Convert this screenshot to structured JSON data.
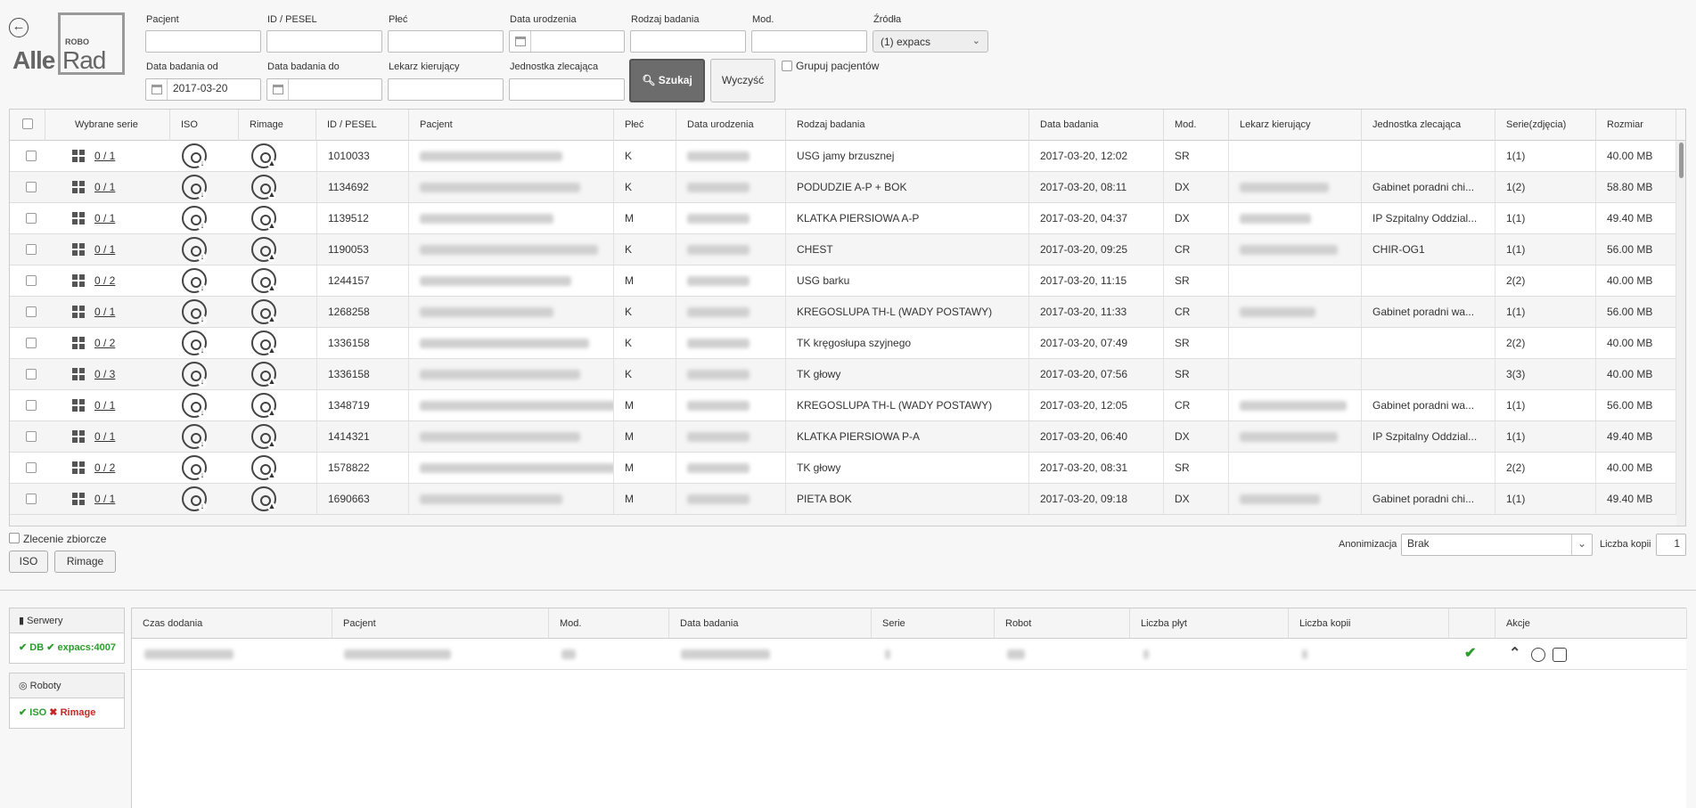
{
  "logo": {
    "alle": "Alle",
    "robo": "ROBO",
    "rad": "Rad"
  },
  "filters": {
    "pacjent": "Pacjent",
    "id_pesel": "ID / PESEL",
    "plec": "Płeć",
    "data_urodzenia": "Data urodzenia",
    "rodzaj_badania": "Rodzaj badania",
    "mod": "Mod.",
    "zrodla": "Źródła",
    "zrodla_value": "(1) expacs",
    "data_od": "Data badania od",
    "data_od_value": "2017-03-20",
    "data_do": "Data badania do",
    "lekarz": "Lekarz kierujący",
    "jednostka": "Jednostka zlecająca",
    "search_label": "Szukaj",
    "clear_label": "Wyczyść",
    "group_label": "Grupuj pacjentów"
  },
  "table": {
    "headers": [
      "Wybrane serie",
      "ISO",
      "Rimage",
      "ID / PESEL",
      "Pacjent",
      "Płeć",
      "Data urodzenia",
      "Rodzaj badania",
      "Data badania",
      "Mod.",
      "Lekarz kierujący",
      "Jednostka zlecająca",
      "Serie(zdjęcia)",
      "Rozmiar"
    ],
    "rows": [
      {
        "sel": "0 / 1",
        "id": "1010033",
        "plec": "K",
        "rodzaj": "USG jamy brzusznej",
        "data": "2017-03-20, 12:02",
        "mod": "SR",
        "lekarz": false,
        "jednostka": "",
        "serie": "1(1)",
        "rozmiar": "40.00 MB"
      },
      {
        "sel": "0 / 1",
        "id": "1134692",
        "plec": "K",
        "rodzaj": "PODUDZIE A-P + BOK",
        "data": "2017-03-20, 08:11",
        "mod": "DX",
        "lekarz": true,
        "jednostka": "Gabinet poradni chi...",
        "serie": "1(2)",
        "rozmiar": "58.80 MB"
      },
      {
        "sel": "0 / 1",
        "id": "1139512",
        "plec": "M",
        "rodzaj": "KLATKA PIERSIOWA A-P",
        "data": "2017-03-20, 04:37",
        "mod": "DX",
        "lekarz": true,
        "jednostka": "IP Szpitalny Oddzial...",
        "serie": "1(1)",
        "rozmiar": "49.40 MB"
      },
      {
        "sel": "0 / 1",
        "id": "1190053",
        "plec": "K",
        "rodzaj": "CHEST",
        "data": "2017-03-20, 09:25",
        "mod": "CR",
        "lekarz": true,
        "jednostka": "CHIR-OG1",
        "serie": "1(1)",
        "rozmiar": "56.00 MB"
      },
      {
        "sel": "0 / 2",
        "id": "1244157",
        "plec": "M",
        "rodzaj": "USG barku",
        "data": "2017-03-20, 11:15",
        "mod": "SR",
        "lekarz": false,
        "jednostka": "",
        "serie": "2(2)",
        "rozmiar": "40.00 MB"
      },
      {
        "sel": "0 / 1",
        "id": "1268258",
        "plec": "K",
        "rodzaj": "KREGOSLUPA TH-L (WADY POSTAWY)",
        "data": "2017-03-20, 11:33",
        "mod": "CR",
        "lekarz": true,
        "jednostka": "Gabinet poradni wa...",
        "serie": "1(1)",
        "rozmiar": "56.00 MB"
      },
      {
        "sel": "0 / 2",
        "id": "1336158",
        "plec": "K",
        "rodzaj": "TK kręgosłupa szyjnego",
        "data": "2017-03-20, 07:49",
        "mod": "SR",
        "lekarz": false,
        "jednostka": "",
        "serie": "2(2)",
        "rozmiar": "40.00 MB"
      },
      {
        "sel": "0 / 3",
        "id": "1336158",
        "plec": "K",
        "rodzaj": "TK głowy",
        "data": "2017-03-20, 07:56",
        "mod": "SR",
        "lekarz": false,
        "jednostka": "",
        "serie": "3(3)",
        "rozmiar": "40.00 MB"
      },
      {
        "sel": "0 / 1",
        "id": "1348719",
        "plec": "M",
        "rodzaj": "KREGOSLUPA TH-L (WADY POSTAWY)",
        "data": "2017-03-20, 12:05",
        "mod": "CR",
        "lekarz": true,
        "jednostka": "Gabinet poradni wa...",
        "serie": "1(1)",
        "rozmiar": "56.00 MB"
      },
      {
        "sel": "0 / 1",
        "id": "1414321",
        "plec": "M",
        "rodzaj": "KLATKA PIERSIOWA P-A",
        "data": "2017-03-20, 06:40",
        "mod": "DX",
        "lekarz": true,
        "jednostka": "IP Szpitalny Oddzial...",
        "serie": "1(1)",
        "rozmiar": "49.40 MB"
      },
      {
        "sel": "0 / 2",
        "id": "1578822",
        "plec": "M",
        "rodzaj": "TK głowy",
        "data": "2017-03-20, 08:31",
        "mod": "SR",
        "lekarz": false,
        "jednostka": "",
        "serie": "2(2)",
        "rozmiar": "40.00 MB"
      },
      {
        "sel": "0 / 1",
        "id": "1690663",
        "plec": "M",
        "rodzaj": "PIETA BOK",
        "data": "2017-03-20, 09:18",
        "mod": "DX",
        "lekarz": true,
        "jednostka": "Gabinet poradni chi...",
        "serie": "1(1)",
        "rozmiar": "49.40 MB"
      }
    ]
  },
  "bottom": {
    "zlecenie_label": "Zlecenie zbiorcze",
    "iso_btn": "ISO",
    "rimage_btn": "Rimage",
    "anonimizacja_label": "Anonimizacja",
    "anonimizacja_value": "Brak",
    "liczba_kopii_label": "Liczba kopii",
    "liczba_kopii_value": "1"
  },
  "servers": {
    "title": "Serwery",
    "db": "DB",
    "expacs": "expacs:4007"
  },
  "robots": {
    "title": "Roboty",
    "iso": "ISO",
    "rimage": "Rimage"
  },
  "queue": {
    "headers": [
      "Czas dodania",
      "Pacjent",
      "Mod.",
      "Data badania",
      "Serie",
      "Robot",
      "Liczba płyt",
      "Liczba kopii",
      "",
      "Akcje"
    ]
  },
  "colors": {
    "ok": "#2a9d2a",
    "bad": "#c52727",
    "search_btn": "#6c6c6c"
  }
}
